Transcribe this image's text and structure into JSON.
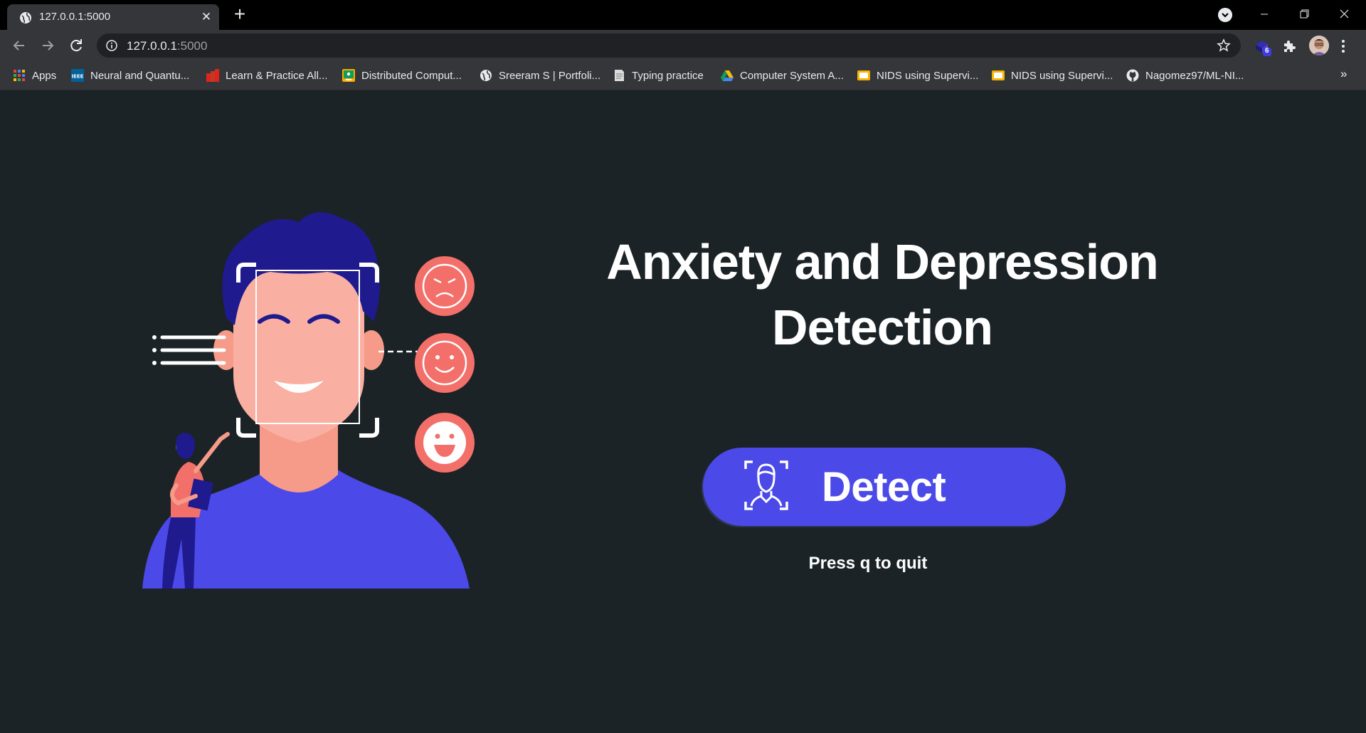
{
  "browser": {
    "tab": {
      "title": "127.0.0.1:5000",
      "close_glyph": "✕"
    },
    "new_tab_glyph": "+",
    "window_controls": {
      "minimize": "—",
      "maximize": "❐",
      "close": "✕"
    },
    "address": {
      "host": "127.0.0.1",
      "port": ":5000"
    },
    "extensions_badge": "6",
    "bookmarks": [
      {
        "label": "Apps",
        "icon": "apps-grid-icon"
      },
      {
        "label": "Neural and Quantu...",
        "icon": "ieee-icon"
      },
      {
        "label": "Learn & Practice All...",
        "icon": "practice-icon"
      },
      {
        "label": "Distributed Comput...",
        "icon": "classroom-icon"
      },
      {
        "label": "Sreeram S | Portfoli...",
        "icon": "globe-icon"
      },
      {
        "label": "Typing practice",
        "icon": "typing-icon"
      },
      {
        "label": "Computer System A...",
        "icon": "drive-icon"
      },
      {
        "label": "NIDS using Supervi...",
        "icon": "slides-icon"
      },
      {
        "label": "NIDS using Supervi...",
        "icon": "slides-icon"
      },
      {
        "label": "Nagomez97/ML-NI...",
        "icon": "github-icon"
      }
    ],
    "bookmarks_overflow": "»"
  },
  "page": {
    "title_line1": "Anxiety and Depression",
    "title_line2": "Detection",
    "detect_button": "Detect",
    "quit_hint": "Press q to quit"
  },
  "colors": {
    "page_background": "#1b2327",
    "button": "#4b4ae8",
    "emoji_circles": "#f3706a"
  }
}
